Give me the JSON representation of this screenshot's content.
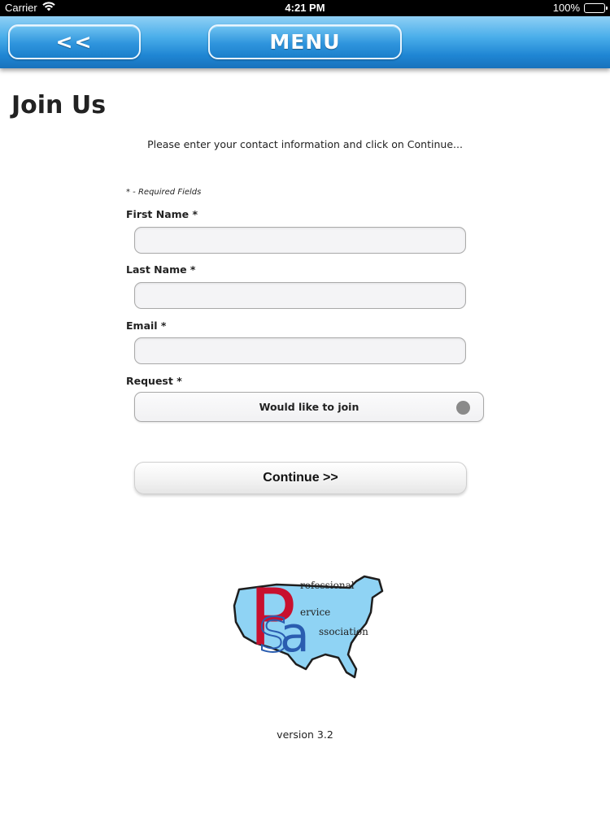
{
  "status_bar": {
    "carrier": "Carrier",
    "time": "4:21 PM",
    "battery": "100%",
    "battery_level": 1.0,
    "wifi_icon": "wifi-icon",
    "battery_icon": "battery-icon"
  },
  "nav": {
    "back_label": "<<",
    "menu_label": "MENU"
  },
  "page": {
    "title": "Join Us",
    "instructions": "Please enter your contact information and click on Continue...",
    "required_note": "* - Required Fields"
  },
  "form": {
    "first_name": {
      "label": "First Name *",
      "value": ""
    },
    "last_name": {
      "label": "Last Name *",
      "value": ""
    },
    "email": {
      "label": "Email *",
      "value": ""
    },
    "request": {
      "label": "Request *",
      "selected": "Would like to join"
    },
    "continue_label": "Continue >>"
  },
  "logo": {
    "letters": [
      "P",
      "S",
      "a"
    ],
    "words": [
      "rofessional",
      "ervice",
      "ssociation"
    ]
  },
  "footer": {
    "version": "version 3.2"
  },
  "colors": {
    "nav_blue": "#1f86d4",
    "logo_red": "#c8102e",
    "logo_blue": "#2a5db0",
    "map_fill": "#8fd3f4"
  }
}
